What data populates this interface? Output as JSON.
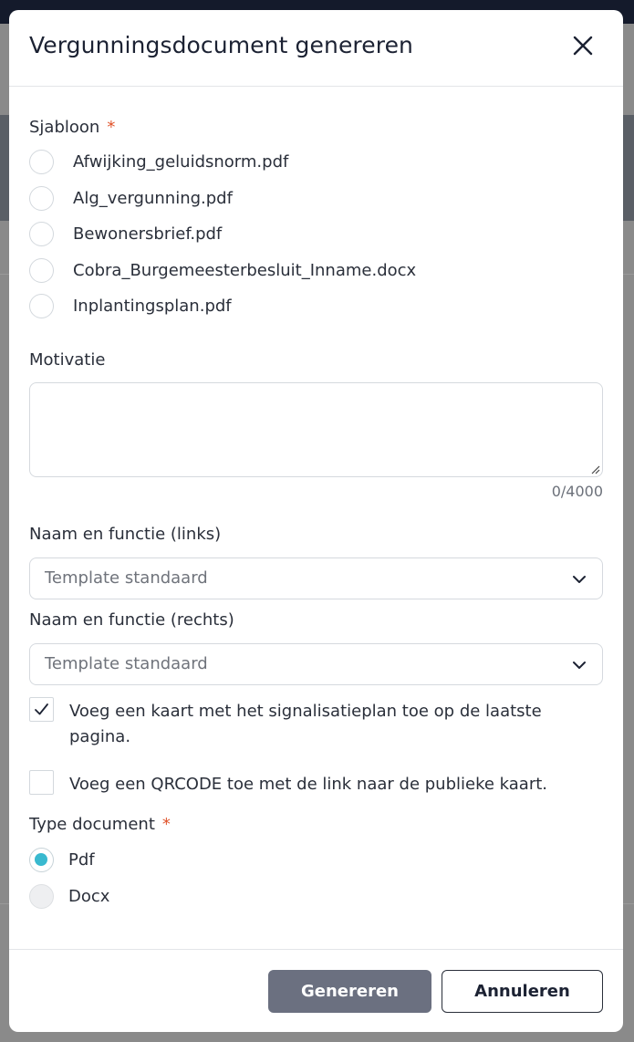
{
  "modal": {
    "title": "Vergunningsdocument genereren",
    "close_icon": "close-icon"
  },
  "template_section": {
    "label": "Sjabloon",
    "required_mark": "*",
    "options": [
      "Afwijking_geluidsnorm.pdf",
      "Alg_vergunning.pdf",
      "Bewonersbrief.pdf",
      "Cobra_Burgemeesterbesluit_Inname.docx",
      "Inplantingsplan.pdf"
    ]
  },
  "motivation": {
    "label": "Motivatie",
    "value": "",
    "counter": "0/4000"
  },
  "name_left": {
    "label": "Naam en functie (links)",
    "selected": "Template standaard",
    "icon": "chevron-down-icon"
  },
  "name_right": {
    "label": "Naam en functie (rechts)",
    "selected": "Template standaard",
    "icon": "chevron-down-icon"
  },
  "checkboxes": {
    "map": {
      "label": "Voeg een kaart met het signalisatieplan toe op de laatste pagina.",
      "checked": true
    },
    "qrcode": {
      "label": "Voeg een QRCODE toe met de link naar de publieke kaart.",
      "checked": false
    }
  },
  "document_type": {
    "label": "Type document",
    "required_mark": "*",
    "options": [
      {
        "label": "Pdf",
        "selected": true
      },
      {
        "label": "Docx",
        "selected": false,
        "disabled": true
      }
    ]
  },
  "footer": {
    "generate_label": "Genereren",
    "cancel_label": "Annuleren"
  },
  "colors": {
    "accent": "#39b9cf",
    "required": "#e0532a",
    "primary_button": "#6b7080"
  }
}
